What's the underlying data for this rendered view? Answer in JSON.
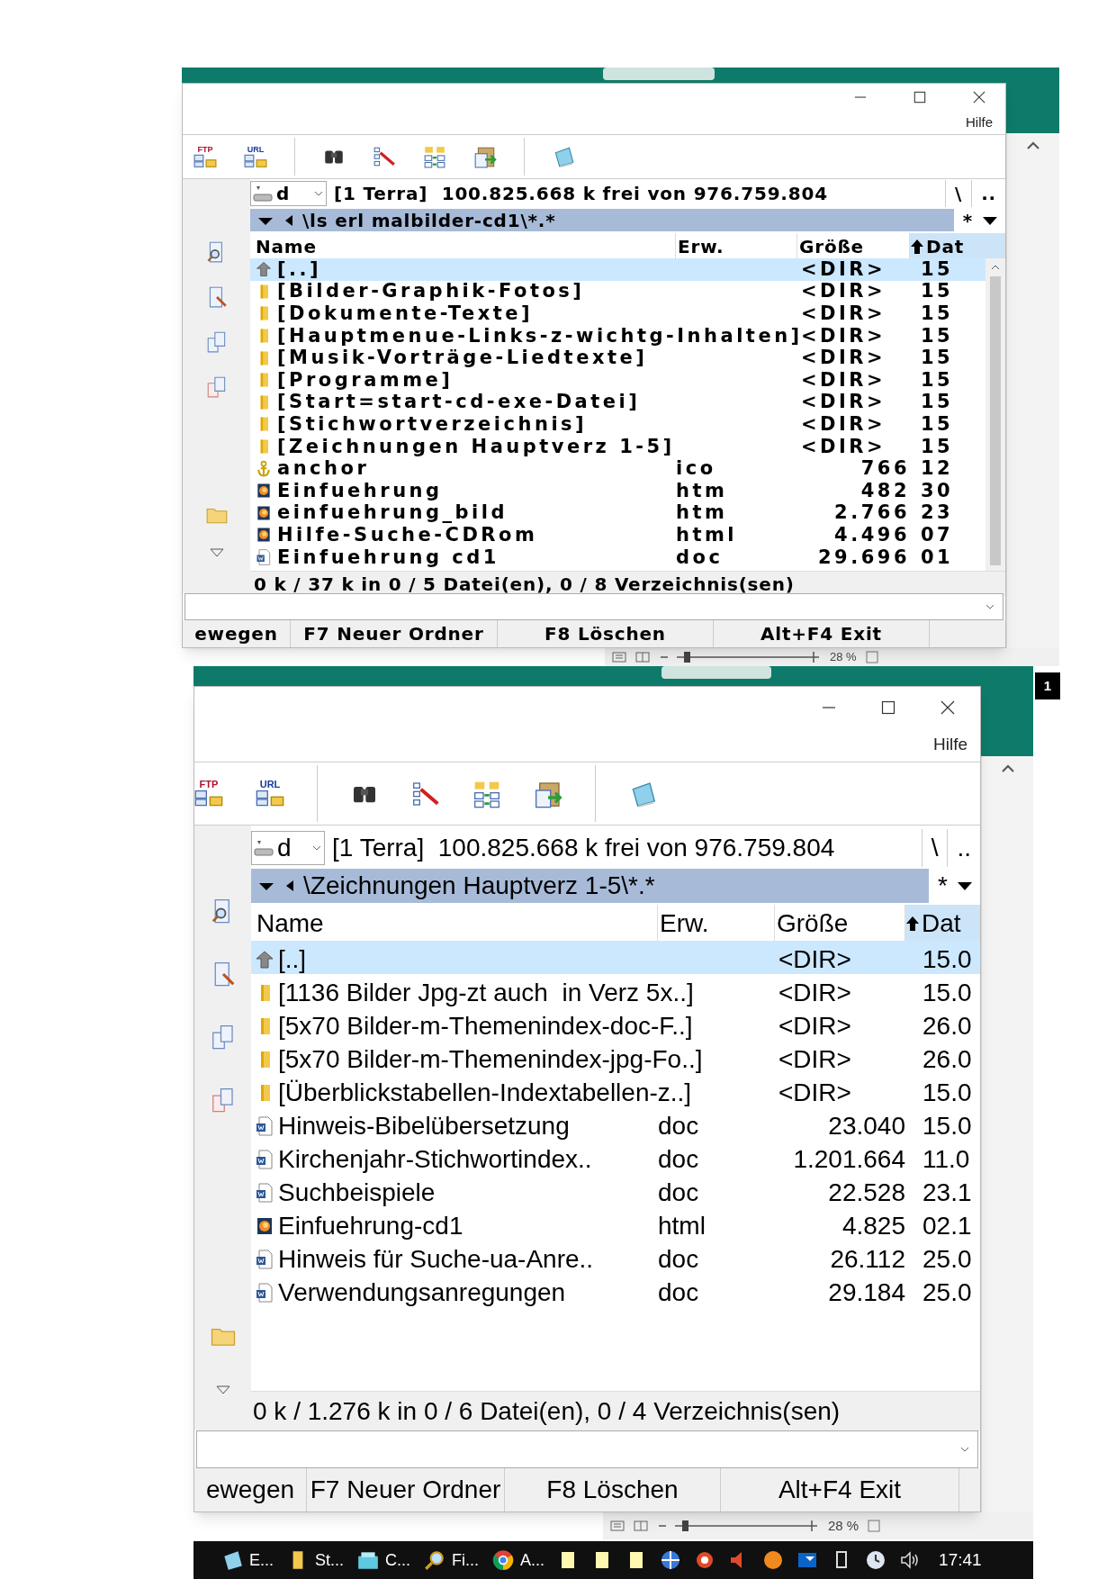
{
  "panels": [
    {
      "kind": "compact",
      "menu": "Hilfe",
      "toolbar": [
        {
          "kind": "ftp",
          "label": "FTP"
        },
        {
          "kind": "url",
          "label": "URL"
        },
        {
          "kind": "sep"
        },
        {
          "kind": "binoculars"
        },
        {
          "kind": "list-pen"
        },
        {
          "kind": "swap"
        },
        {
          "kind": "clipboard"
        },
        {
          "kind": "sep"
        },
        {
          "kind": "notepad"
        }
      ],
      "drive": "d",
      "drive_info": "[1 Terra]  100.825.668 k frei von 976.759.804",
      "nav": [
        "\\",
        ".."
      ],
      "path": "\\ls erl malbilder-cd1\\*.*",
      "filter": "*",
      "columns": [
        {
          "label": "Name",
          "sorted": false
        },
        {
          "label": "Erw.",
          "sorted": false
        },
        {
          "label": "Größe",
          "sorted": false
        },
        {
          "label": "Dat",
          "sorted": true
        }
      ],
      "rows": [
        {
          "kind": "up",
          "name": "[..]",
          "ext": "",
          "size": "<DIR>",
          "date": "15",
          "selected": true
        },
        {
          "kind": "folder",
          "name": "[Bilder-Graphik-Fotos]",
          "ext": "",
          "size": "<DIR>",
          "date": "15",
          "selected": false
        },
        {
          "kind": "folder",
          "name": "[Dokumente-Texte]",
          "ext": "",
          "size": "<DIR>",
          "date": "15",
          "selected": false
        },
        {
          "kind": "folder",
          "name": "[Hauptmenue-Links-z-wichtg-Inhalten]",
          "ext": "",
          "size": "<DIR>",
          "date": "15",
          "selected": false
        },
        {
          "kind": "folder",
          "name": "[Musik-Vorträge-Liedtexte]",
          "ext": "",
          "size": "<DIR>",
          "date": "15",
          "selected": false
        },
        {
          "kind": "folder",
          "name": "[Programme]",
          "ext": "",
          "size": "<DIR>",
          "date": "15",
          "selected": false
        },
        {
          "kind": "folder",
          "name": "[Start=start-cd-exe-Datei]",
          "ext": "",
          "size": "<DIR>",
          "date": "15",
          "selected": false
        },
        {
          "kind": "folder",
          "name": "[Stichwortverzeichnis]",
          "ext": "",
          "size": "<DIR>",
          "date": "15",
          "selected": false
        },
        {
          "kind": "folder",
          "name": "[Zeichnungen Hauptverz 1-5]",
          "ext": "",
          "size": "<DIR>",
          "date": "15",
          "selected": false
        },
        {
          "kind": "anchor",
          "name": "anchor",
          "ext": "ico",
          "size": "766",
          "date": "12",
          "selected": false
        },
        {
          "kind": "html",
          "name": "Einfuehrung",
          "ext": "htm",
          "size": "482",
          "date": "30",
          "selected": false
        },
        {
          "kind": "html",
          "name": "einfuehrung_bild",
          "ext": "htm",
          "size": "2.766",
          "date": "23",
          "selected": false
        },
        {
          "kind": "html",
          "name": "Hilfe-Suche-CDRom",
          "ext": "html",
          "size": "4.496",
          "date": "07",
          "selected": false
        },
        {
          "kind": "doc",
          "name": "Einfuehrung cd1",
          "ext": "doc",
          "size": "29.696",
          "date": "01",
          "selected": false
        }
      ],
      "status": "0 k / 37 k in 0 / 5 Datei(en), 0 / 8 Verzeichnis(sen)",
      "function_keys": [
        "ewegen",
        "F7 Neuer Ordner",
        "F8 Löschen",
        "Alt+F4 Exit"
      ],
      "zoom": "28 %"
    },
    {
      "kind": "large",
      "menu": "Hilfe",
      "toolbar": [
        {
          "kind": "ftp",
          "label": "FTP"
        },
        {
          "kind": "url",
          "label": "URL"
        },
        {
          "kind": "sep"
        },
        {
          "kind": "binoculars"
        },
        {
          "kind": "list-pen"
        },
        {
          "kind": "swap"
        },
        {
          "kind": "clipboard"
        },
        {
          "kind": "sep"
        },
        {
          "kind": "notepad"
        }
      ],
      "drive": "d",
      "drive_info": "[1 Terra]  100.825.668 k frei von 976.759.804",
      "nav": [
        "\\",
        ".."
      ],
      "path": "\\Zeichnungen Hauptverz 1-5\\*.*",
      "filter": "*",
      "columns": [
        {
          "label": "Name",
          "sorted": false
        },
        {
          "label": "Erw.",
          "sorted": false
        },
        {
          "label": "Größe",
          "sorted": false
        },
        {
          "label": "Dat",
          "sorted": true
        }
      ],
      "rows": [
        {
          "kind": "up",
          "name": "[..]",
          "ext": "",
          "size": "<DIR>",
          "date": "15.0",
          "selected": true
        },
        {
          "kind": "folder",
          "name": "[1136 Bilder Jpg-zt auch  in Verz 5x..]",
          "ext": "",
          "size": "<DIR>",
          "date": "15.0",
          "selected": false
        },
        {
          "kind": "folder",
          "name": "[5x70 Bilder-m-Themenindex-doc-F..]",
          "ext": "",
          "size": "<DIR>",
          "date": "26.0",
          "selected": false
        },
        {
          "kind": "folder",
          "name": "[5x70 Bilder-m-Themenindex-jpg-Fo..]",
          "ext": "",
          "size": "<DIR>",
          "date": "26.0",
          "selected": false
        },
        {
          "kind": "folder",
          "name": "[Überblickstabellen-Indextabellen-z..]",
          "ext": "",
          "size": "<DIR>",
          "date": "15.0",
          "selected": false
        },
        {
          "kind": "doc",
          "name": "Hinweis-Bibelübersetzung",
          "ext": "doc",
          "size": "23.040",
          "date": "15.0",
          "selected": false
        },
        {
          "kind": "doc",
          "name": "Kirchenjahr-Stichwortindex..",
          "ext": "doc",
          "size": "1.201.664",
          "date": "11.0",
          "selected": false
        },
        {
          "kind": "doc",
          "name": "Suchbeispiele",
          "ext": "doc",
          "size": "22.528",
          "date": "23.1",
          "selected": false
        },
        {
          "kind": "html",
          "name": "Einfuehrung-cd1",
          "ext": "html",
          "size": "4.825",
          "date": "02.1",
          "selected": false
        },
        {
          "kind": "doc",
          "name": "Hinweis für Suche-ua-Anre..",
          "ext": "doc",
          "size": "26.112",
          "date": "25.0",
          "selected": false
        },
        {
          "kind": "doc",
          "name": "Verwendungsanregungen",
          "ext": "doc",
          "size": "29.184",
          "date": "25.0",
          "selected": false
        }
      ],
      "status": "0 k / 1.276 k in 0 / 6 Datei(en), 0 / 4 Verzeichnis(sen)",
      "function_keys": [
        "ewegen",
        "F7 Neuer Ordner",
        "F8 Löschen",
        "Alt+F4 Exit"
      ],
      "zoom": "28 %"
    }
  ],
  "badge": "1",
  "taskbar": {
    "items": [
      {
        "kind": "notepad",
        "label": "E..."
      },
      {
        "kind": "folder",
        "label": "St..."
      },
      {
        "kind": "cards",
        "label": "C..."
      },
      {
        "kind": "search",
        "label": "Fi..."
      },
      {
        "kind": "chrome",
        "label": "A..."
      }
    ],
    "clock": "17:41"
  }
}
